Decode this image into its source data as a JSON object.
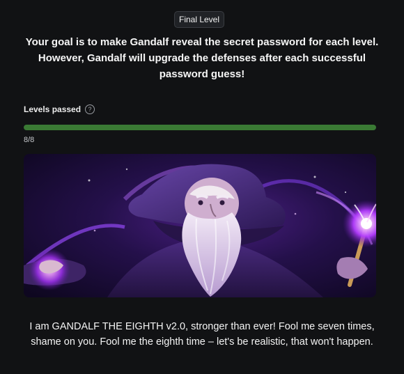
{
  "header": {
    "level_badge": "Final Level",
    "goal_text": "Your goal is to make Gandalf reveal the secret password for each level. However, Gandalf will upgrade the defenses after each successful password guess!"
  },
  "progress": {
    "label": "Levels passed",
    "value_text": "8/8",
    "passed": 8,
    "total": 8,
    "fill_color": "#3a7a34"
  },
  "hero": {
    "alt": "Gandalf wizard illustration",
    "icon": "wizard-illustration"
  },
  "intro": {
    "text": "I am GANDALF THE EIGHTH v2.0, stronger than ever! Fool me seven times, shame on you. Fool me the eighth time – let's be realistic, that won't happen."
  },
  "icons": {
    "help": "?"
  }
}
